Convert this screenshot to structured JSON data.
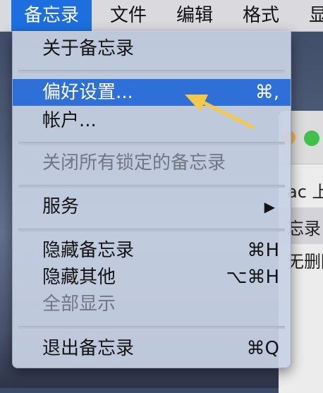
{
  "menubar": {
    "items": [
      "备忘录",
      "文件",
      "编辑",
      "格式",
      "显"
    ]
  },
  "background_window": {
    "line1": "ac 上",
    "line2": "忘录",
    "line3": "无删除"
  },
  "menu": {
    "about": "关于备忘录",
    "preferences": "偏好设置...",
    "preferences_shortcut": "⌘,",
    "accounts": "帐户...",
    "close_locked": "关闭所有锁定的备忘录",
    "services": "服务",
    "services_arrow": "▶",
    "hide": "隐藏备忘录",
    "hide_shortcut": "⌘H",
    "hide_others": "隐藏其他",
    "hide_others_shortcut": "⌥⌘H",
    "show_all": "全部显示",
    "quit": "退出备忘录",
    "quit_shortcut": "⌘Q"
  },
  "colors": {
    "selection": "#2f6fd8",
    "annotation_arrow": "#f2c94c"
  }
}
